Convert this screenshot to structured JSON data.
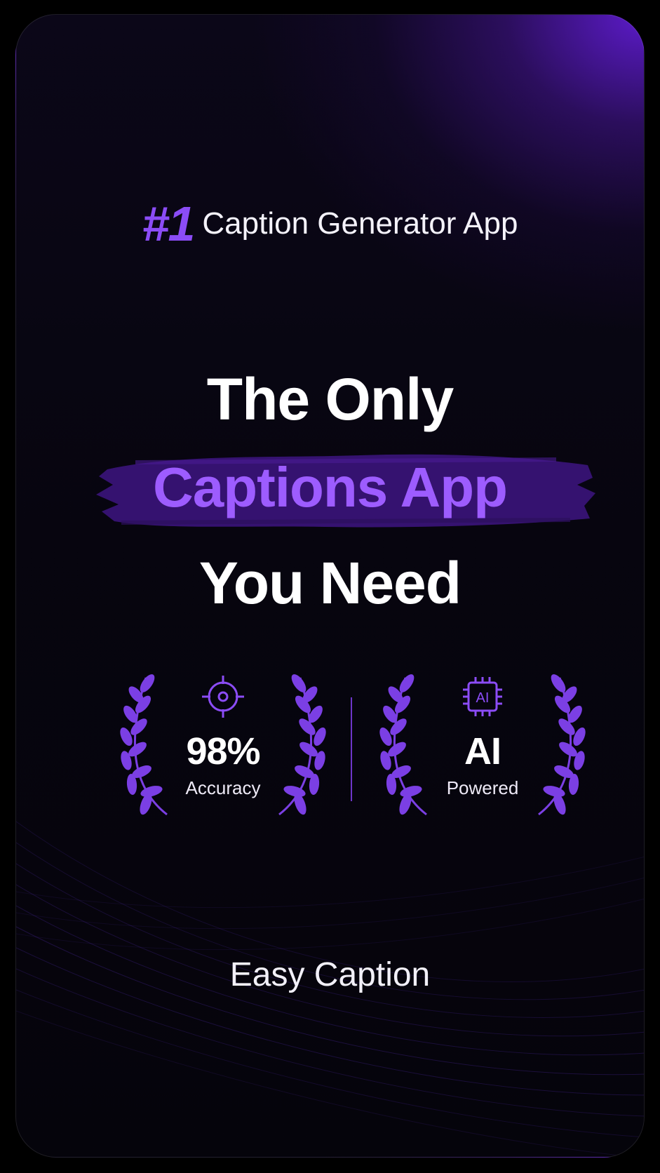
{
  "tagline": {
    "rank": "#1",
    "text": "Caption Generator App"
  },
  "headline": {
    "line1": "The Only",
    "line2": "Captions App",
    "line3": "You Need"
  },
  "badges": [
    {
      "icon": "target-icon",
      "value": "98%",
      "label": "Accuracy"
    },
    {
      "icon": "ai-chip-icon",
      "value": "AI",
      "label": "Powered",
      "icon_text": "AI"
    }
  ],
  "brand": "Easy Caption",
  "colors": {
    "background": "#07050f",
    "accent": "#8b4cf6",
    "accent_light": "#9d5cff",
    "brush": "#3a1478",
    "text": "#ffffff"
  }
}
